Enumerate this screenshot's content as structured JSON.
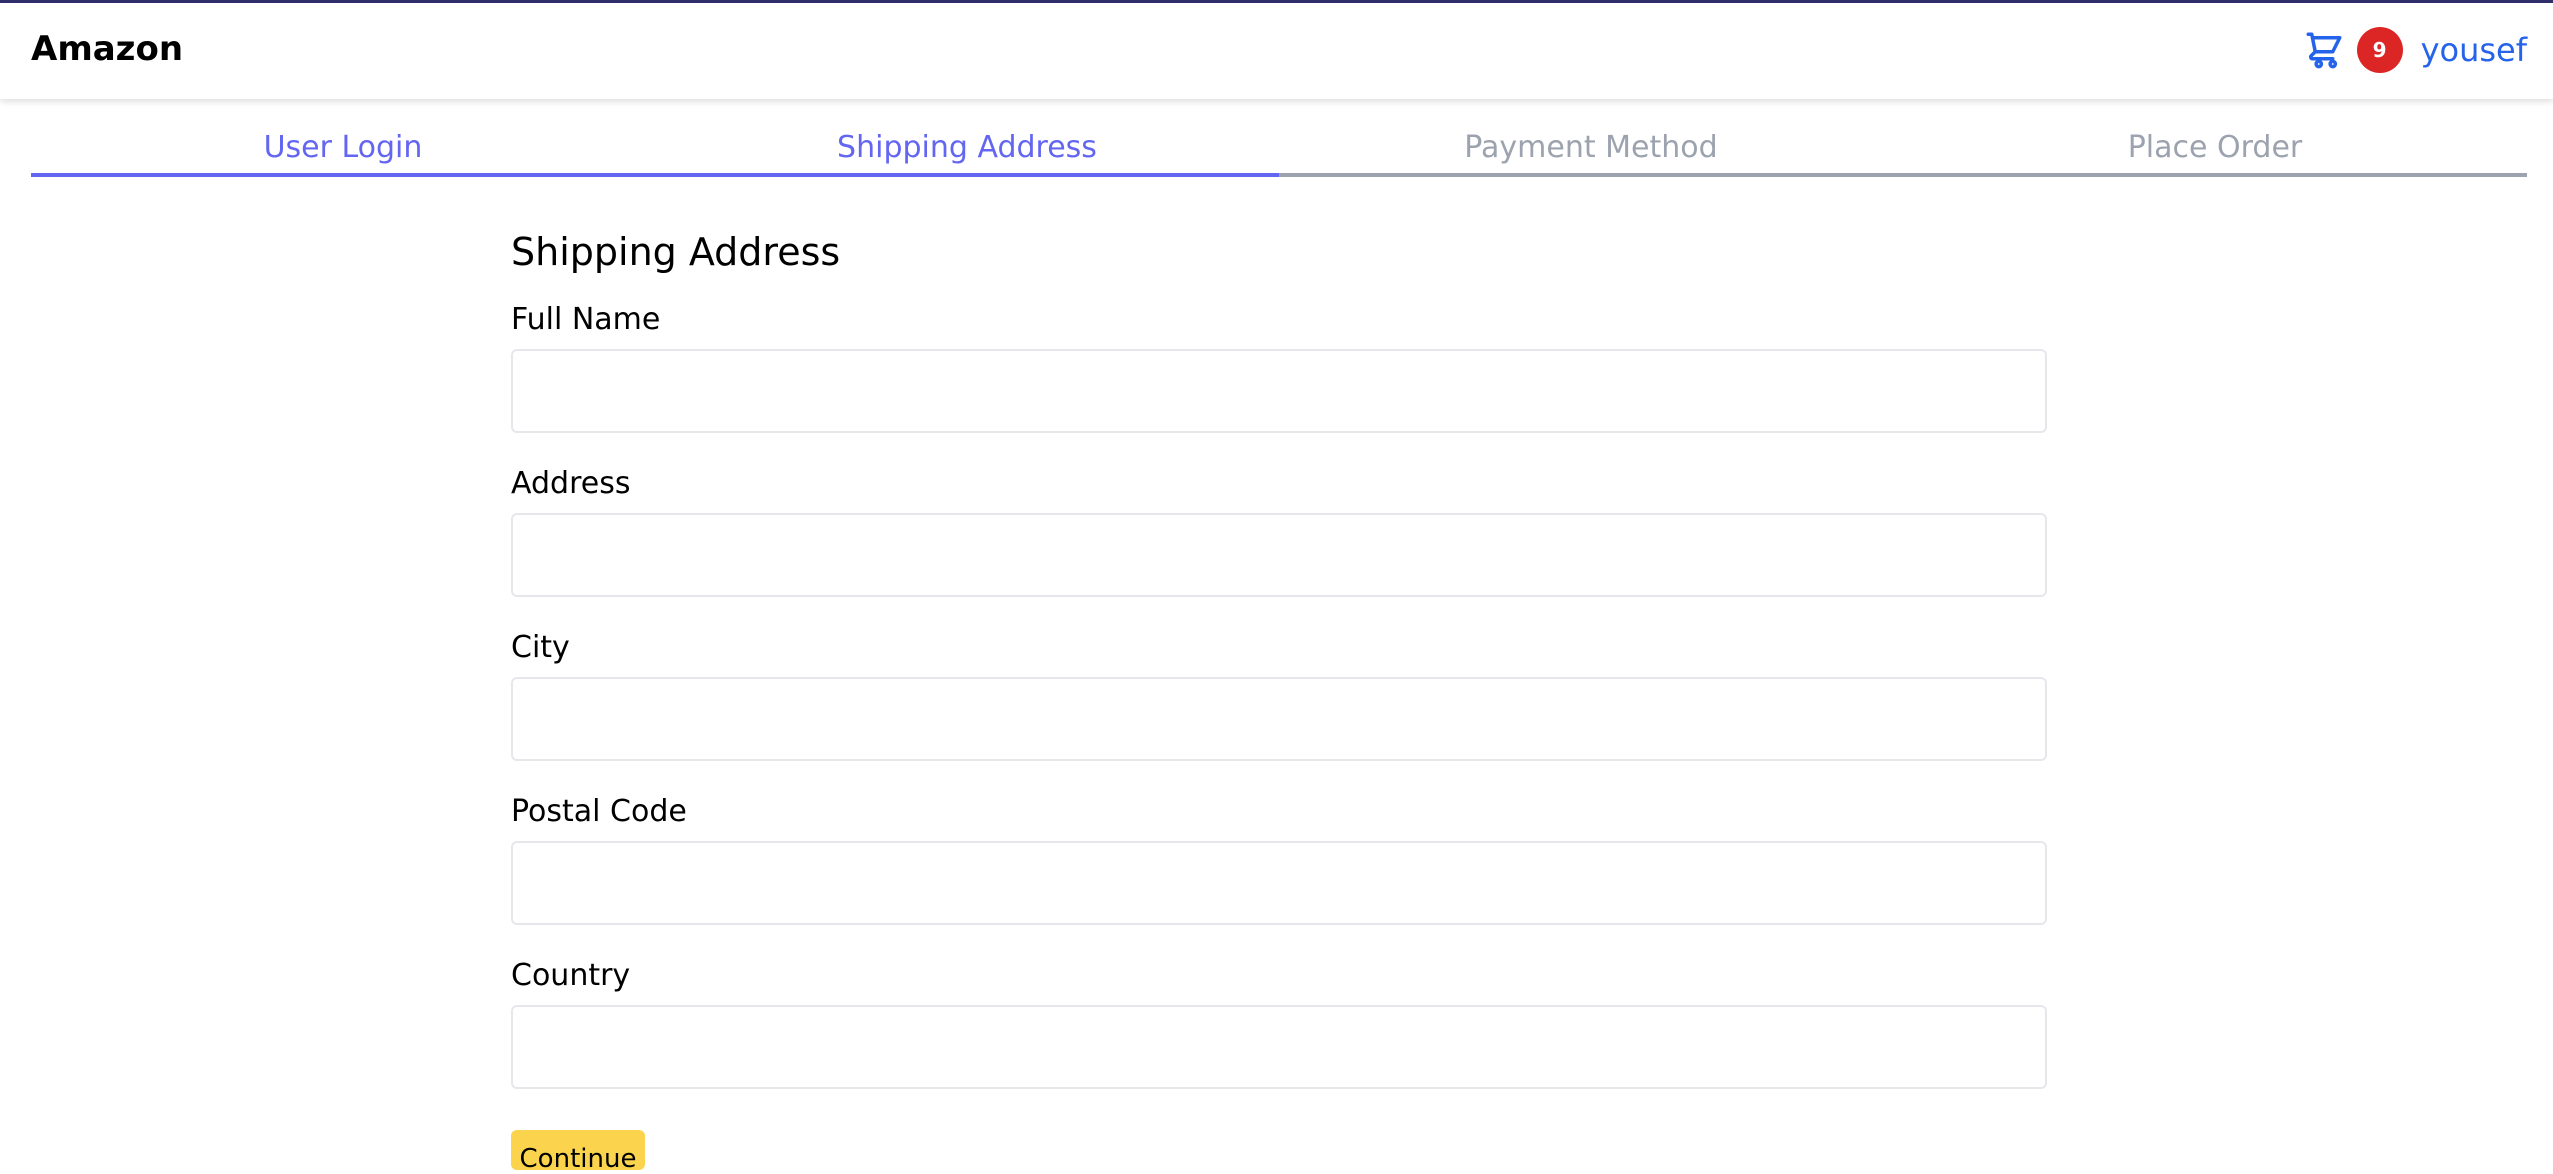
{
  "header": {
    "brand": "Amazon",
    "cart": {
      "icon": "cart-icon",
      "count": "9"
    },
    "user_name": "yousef"
  },
  "steps": [
    {
      "label": "User Login",
      "active": true
    },
    {
      "label": "Shipping Address",
      "active": true
    },
    {
      "label": "Payment Method",
      "active": false
    },
    {
      "label": "Place Order",
      "active": false
    }
  ],
  "form": {
    "title": "Shipping Address",
    "fields": [
      {
        "label": "Full Name",
        "value": ""
      },
      {
        "label": "Address",
        "value": ""
      },
      {
        "label": "City",
        "value": ""
      },
      {
        "label": "Postal Code",
        "value": ""
      },
      {
        "label": "Country",
        "value": ""
      }
    ],
    "submit_label": "Continue"
  },
  "colors": {
    "accent": "#6366f1",
    "inactive": "#9ca3af",
    "link": "#2563eb",
    "badge": "#dc2626",
    "button": "#fcd34d",
    "topline": "#312e6b"
  }
}
